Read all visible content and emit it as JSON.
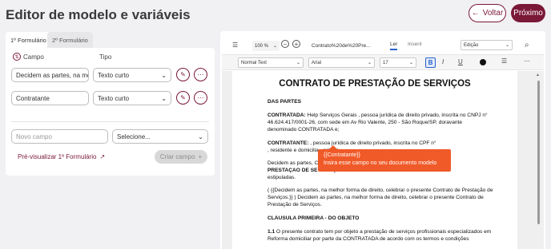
{
  "header": {
    "title": "Editor de modelo e variáveis",
    "back_label": "Voltar",
    "next_label": "Próximo"
  },
  "left": {
    "tabs": [
      "1º Formulário",
      "2º Formulário"
    ],
    "col_campo": "Campo",
    "col_tipo": "Tipo",
    "rows": [
      {
        "field": "Decidem as partes, na me",
        "type": "Texto curto"
      },
      {
        "field": "Contratante",
        "type": "Texto curto"
      }
    ],
    "new_field_placeholder": "Novo campo",
    "select_placeholder": "Selecione...",
    "preview_link": "Pré-visualizar 1º Formulário",
    "create_label": "Criar campo"
  },
  "toolbar": {
    "zoom": "100 %",
    "filename": "Contrato%20de%20Pre...",
    "tab_ler": "Ler",
    "tab_inserir": "Inserir",
    "mode": "Edição",
    "style": "Normal Text",
    "font": "Arial",
    "size": "17"
  },
  "document": {
    "title": "CONTRATO DE PRESTAÇÃO DE SERVIÇOS",
    "lines": [
      {
        "text": "DAS PARTES",
        "bold": true
      },
      {
        "text": "CONTRATADA: Help Serviços Gerais , pessoa jurídica de direito privado, inscrita no CNPJ n°",
        "lead": "CONTRATADA:"
      },
      {
        "text": "46.624.417/0001-26, com sede em Av Rio Valente, 250 - São Roque/SP, doravante"
      },
      {
        "text": "denominado CONTRATADA e;"
      },
      {
        "text": "CONTRATANTE:                          , pessoa jurídica de direito privado, inscrita no CPF n°",
        "lead": "CONTRATANTE:"
      },
      {
        "text": ", residente e domicilia                                                                     , estado         ."
      },
      {
        "text": "Decidem as partes,                                                                        CONTRATO DE"
      },
      {
        "text": "PRESTAÇÃO DE SE                                                                          condições adiante"
      },
      {
        "text": "estipuladas."
      },
      {
        "text": "( {{Decidem as partes, na melhor forma de direito, celebrar o presente Contrato de Prestação de"
      },
      {
        "text": "Serviços.}} ) Decidem as partes, na melhor forma de direito, celebrar o presente Contrato de"
      },
      {
        "text": "Prestação de Serviços."
      },
      {
        "text": "CLÁUSULA PRIMEIRA - DO OBJETO",
        "bold": true
      },
      {
        "text": "1.1 O presente contrato tem por objeto a prestação de serviços profissionais especializados em",
        "lead": "1.1"
      },
      {
        "text": "Reforma domiciliar por parte da CONTRATADA de acordo com os termos e condições"
      }
    ]
  },
  "tooltip": {
    "variable": "{{Contratante}}",
    "message": "Insira esse campo no seu documento modelo"
  },
  "colors": {
    "brand": "#7a1838",
    "tooltip": "#f05a28"
  }
}
